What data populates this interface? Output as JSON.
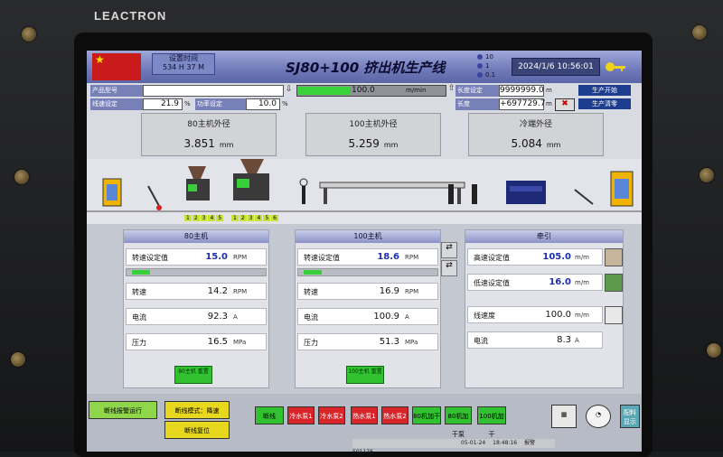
{
  "brand": "LEACTRON",
  "header": {
    "flag_text": "★",
    "clock_top": "设置时间",
    "clock_bottom": "534 H 37 M",
    "title": "SJ80+100 挤出机生产线",
    "radio": [
      "10",
      "1",
      "0.1"
    ],
    "datetime": "2024/1/6 10:56:01"
  },
  "params": {
    "label1": "产品型号",
    "field1": "",
    "label2": "线速设定",
    "field2": "21.9",
    "unit2": "%",
    "label3": "功率设定",
    "field3": "10.0",
    "unit3": "%",
    "progress_value": "100.0",
    "progress_unit": "m/min",
    "progress_fill": 0.35,
    "right_label1": "长度设定",
    "right_value1": "9999999.0",
    "right_unit1": "m",
    "right_label2": "长度",
    "right_value2": "+697729.7",
    "right_unit2": "m",
    "btn_start": "生产开始",
    "btn_clear": "生产清零"
  },
  "diameters": [
    {
      "label": "80主机外径",
      "value": "3.851",
      "unit": "mm"
    },
    {
      "label": "100主机外径",
      "value": "5.259",
      "unit": "mm"
    },
    {
      "label": "冷端外径",
      "value": "5.084",
      "unit": "mm"
    }
  ],
  "process": {
    "zones_a": [
      "1",
      "2",
      "3",
      "4",
      "5"
    ],
    "zones_b": [
      "1",
      "2",
      "3",
      "4",
      "5",
      "6"
    ]
  },
  "panels": {
    "p80": {
      "title": "80主机",
      "setpoint_label": "转速设定值",
      "setpoint_value": "15.0",
      "setpoint_unit": "RPM",
      "speed_label": "转速",
      "speed_value": "14.2",
      "speed_unit": "RPM",
      "current_label": "电流",
      "current_value": "92.3",
      "current_unit": "A",
      "pressure_label": "压力",
      "pressure_value": "16.5",
      "pressure_unit": "MPa",
      "button": "80主机 重置"
    },
    "p100": {
      "title": "100主机",
      "setpoint_label": "转速设定值",
      "setpoint_value": "18.6",
      "setpoint_unit": "RPM",
      "speed_label": "转速",
      "speed_value": "16.9",
      "speed_unit": "RPM",
      "current_label": "电流",
      "current_value": "100.9",
      "current_unit": "A",
      "pressure_label": "压力",
      "pressure_value": "51.3",
      "pressure_unit": "MPa",
      "button": "100主机 重置"
    },
    "haul": {
      "title": "牵引",
      "high_label": "高速设定值",
      "high_value": "105.0",
      "high_unit": "m/m",
      "low_label": "低速设定值",
      "low_value": "16.0",
      "low_unit": "m/m",
      "line_label": "线速度",
      "line_value": "100.0",
      "line_unit": "m/m",
      "current_label": "电流",
      "current_value": "8.3",
      "current_unit": "A"
    }
  },
  "bottom": {
    "b1": "断线报警运行",
    "b2": "断线模式：降速",
    "b3": "断线复位",
    "b4": "断线",
    "b5": "冷水泵1",
    "b6": "冷水泵2",
    "b7": "热水泵1",
    "b8": "热水泵2",
    "b9": "80机加干",
    "b10": "80机加干泵",
    "b11": "100机加干",
    "b12": "配料显示",
    "status_date": "05-01-24",
    "status_time": "18:48:16",
    "status_msg": "报警 501176"
  },
  "colors": {
    "header_blue": "#6f79b8",
    "active_green": "#31c131",
    "alarm_red": "#d9252a",
    "warn_yellow": "#e7d71f"
  }
}
